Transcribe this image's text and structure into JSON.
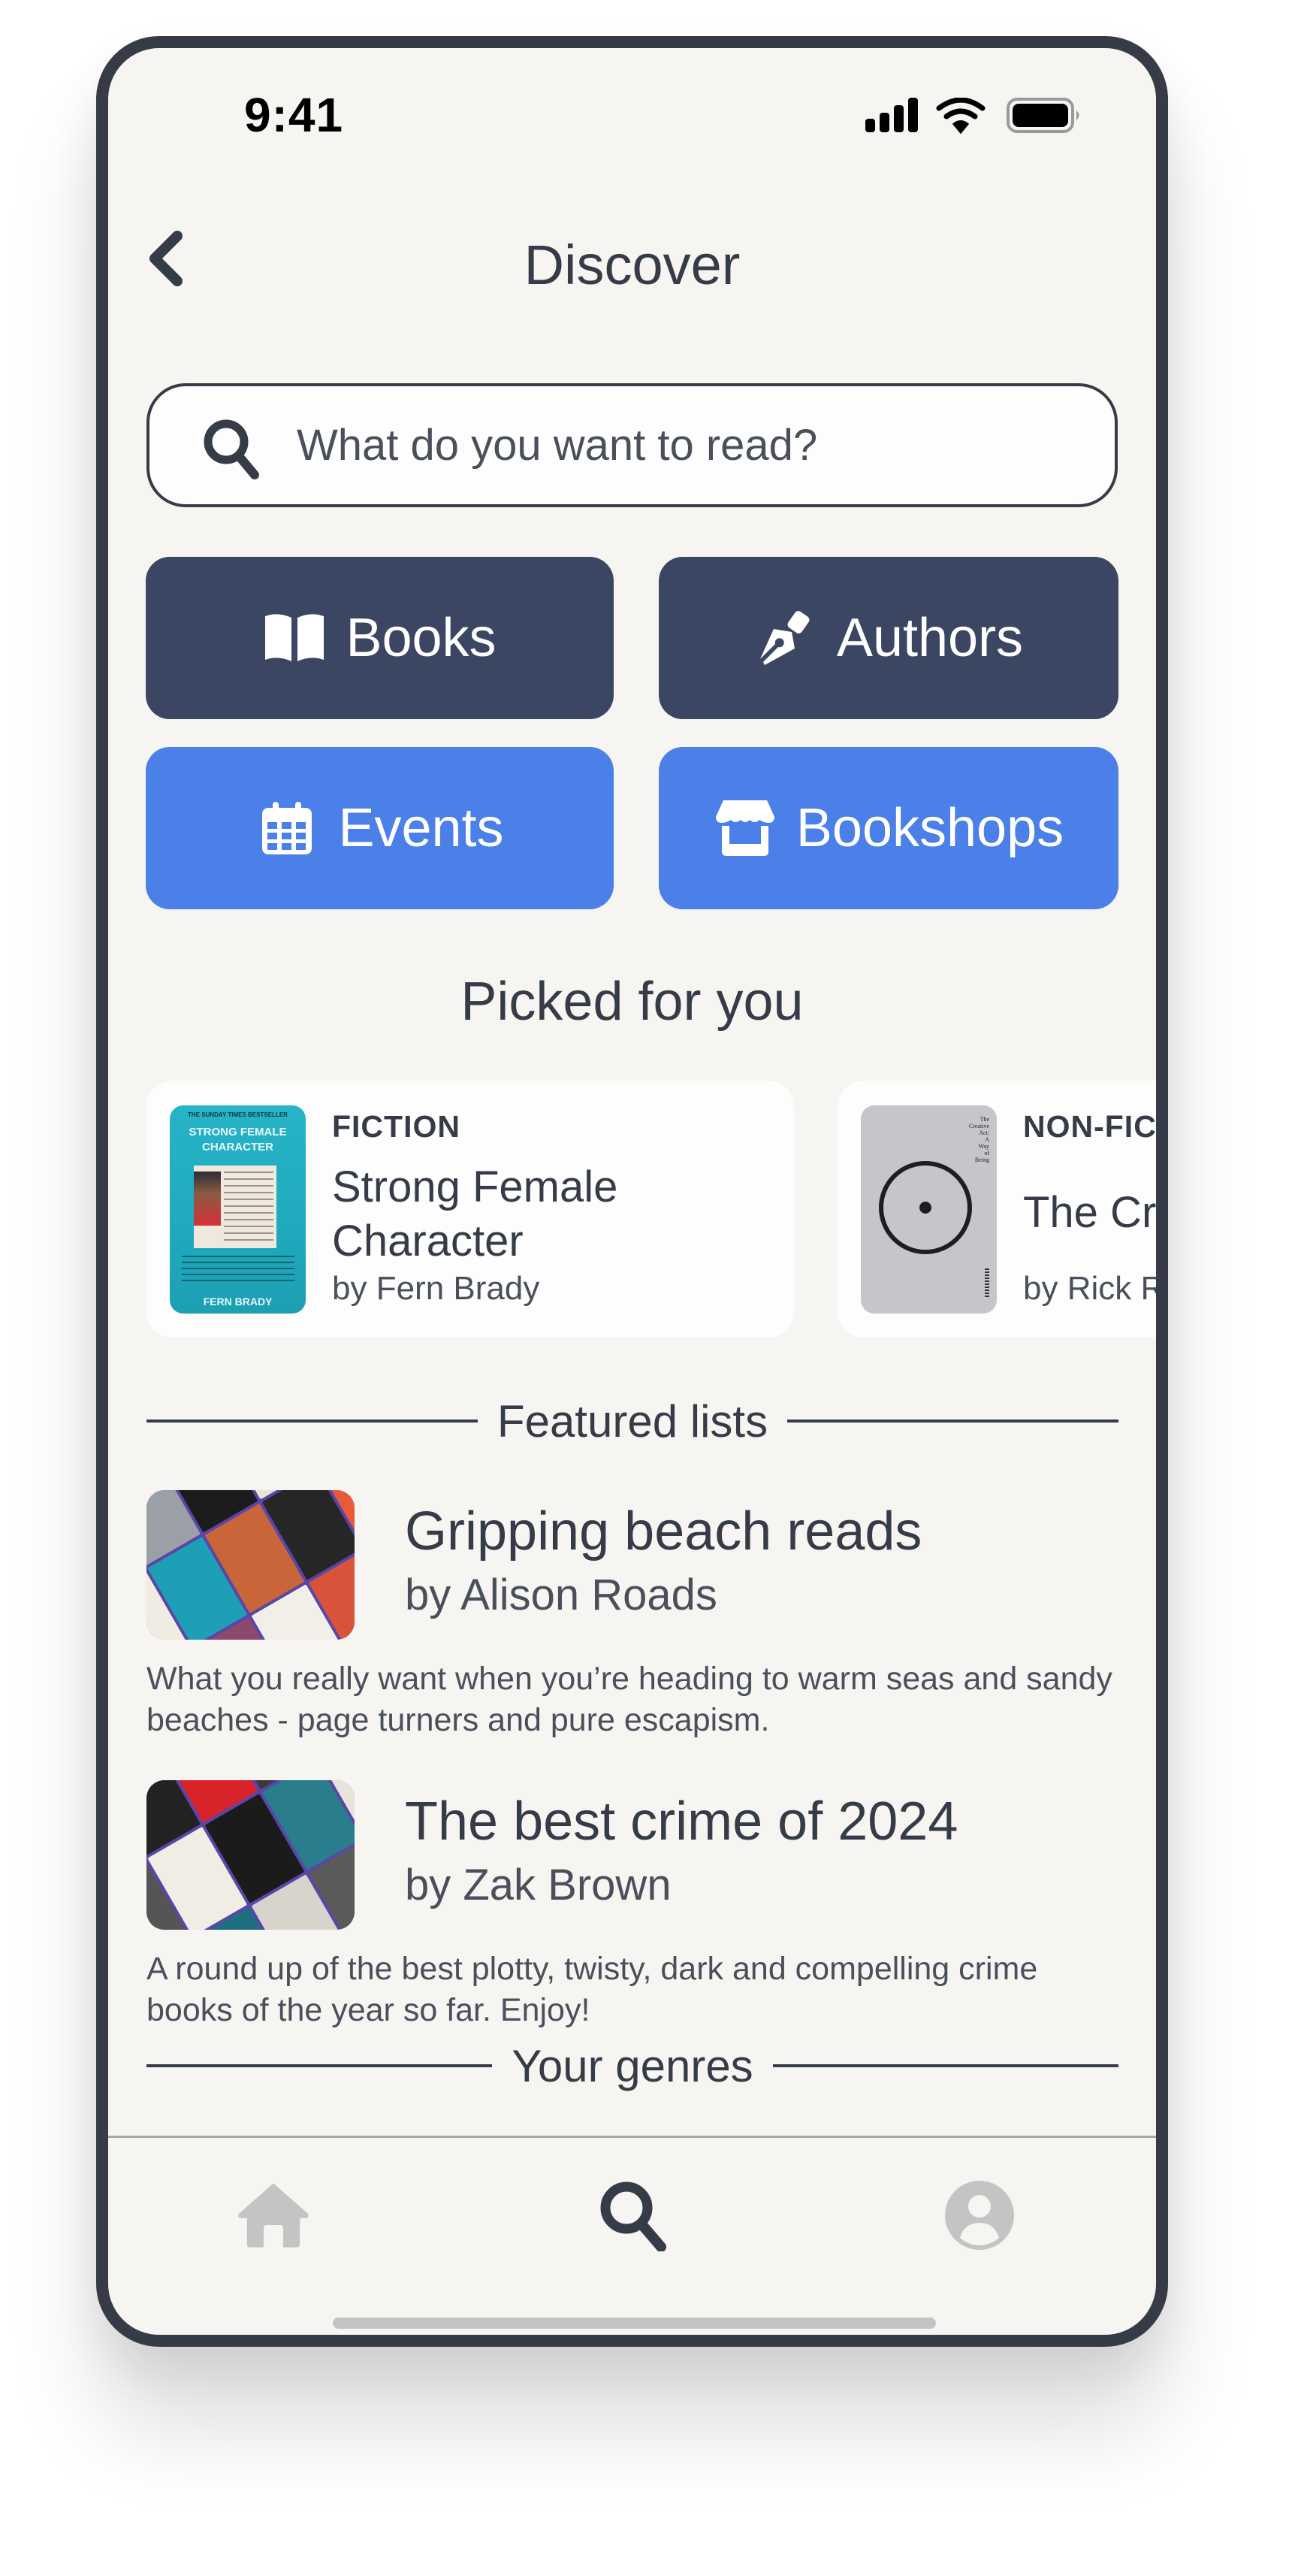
{
  "status_bar": {
    "time": "9:41",
    "icons": [
      "signal-icon",
      "wifi-icon",
      "battery-icon"
    ]
  },
  "header": {
    "title": "Discover",
    "back_icon": "chevron-left-icon"
  },
  "search": {
    "placeholder": "What do you want to read?",
    "value": "",
    "icon": "search-icon"
  },
  "categories": [
    {
      "label": "Books",
      "icon": "book-open-icon",
      "color": "#3b4662"
    },
    {
      "label": "Authors",
      "icon": "pen-nib-icon",
      "color": "#3b4662"
    },
    {
      "label": "Events",
      "icon": "calendar-icon",
      "color": "#4a80e8"
    },
    {
      "label": "Bookshops",
      "icon": "store-icon",
      "color": "#4a80e8"
    }
  ],
  "picked": {
    "title": "Picked for you",
    "items": [
      {
        "genre": "FICTION",
        "title": "Strong Female Character",
        "author": "by Fern Brady",
        "cover": {
          "top_line": "THE SUNDAY TIMES BESTSELLER",
          "title": "STRONG FEMALE CHARACTER",
          "author": "FERN BRADY"
        }
      },
      {
        "genre": "NON-FICTION",
        "title": "The Creative Act",
        "author": "by Rick Rubin",
        "cover": {
          "title": "The Creative Act: A Way of Being"
        }
      }
    ]
  },
  "featured": {
    "title": "Featured lists",
    "items": [
      {
        "title": "Gripping beach reads",
        "author": "by Alison Roads",
        "description": "What you really want when you’re heading to warm seas and sandy beaches - page turners and pure escapism."
      },
      {
        "title": "The best crime of 2024",
        "author": "by Zak Brown",
        "description": "A round up of the best plotty, twisty, dark and compelling crime books of the year so far. Enjoy!"
      }
    ]
  },
  "genres": {
    "title": "Your genres"
  },
  "bottom_nav": {
    "items": [
      {
        "name": "home",
        "icon": "home-icon",
        "active": false
      },
      {
        "name": "search",
        "icon": "search-icon",
        "active": true
      },
      {
        "name": "profile",
        "icon": "user-circle-icon",
        "active": false
      }
    ],
    "active_color": "#363c47",
    "inactive_color": "#c4c4c4"
  },
  "colors": {
    "background": "#f6f5f2",
    "text": "#363c47",
    "frame": "#363c47"
  }
}
